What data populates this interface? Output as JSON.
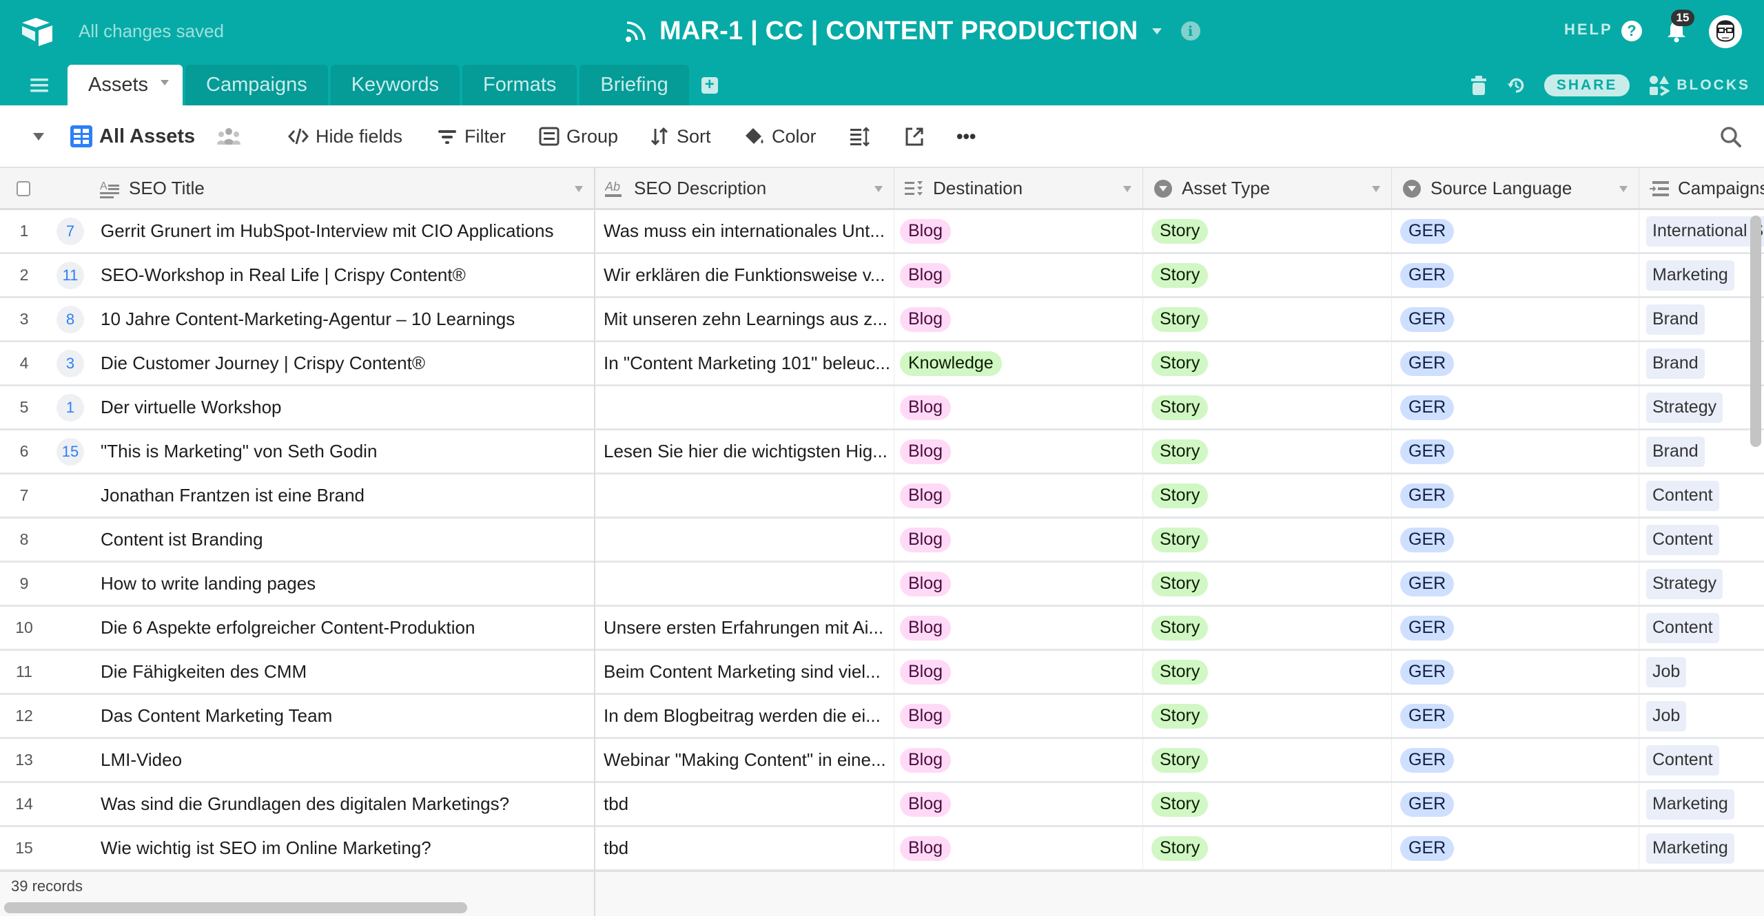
{
  "app": {
    "save_status": "All changes saved",
    "base_title": "MAR-1 | CC | CONTENT PRODUCTION",
    "help_label": "HELP",
    "notification_count": "15",
    "accent_color": "#06aba7"
  },
  "tabs": [
    {
      "label": "Assets",
      "active": true
    },
    {
      "label": "Campaigns",
      "active": false
    },
    {
      "label": "Keywords",
      "active": false
    },
    {
      "label": "Formats",
      "active": false
    },
    {
      "label": "Briefing",
      "active": false
    }
  ],
  "header_actions": {
    "share_label": "SHARE",
    "blocks_label": "BLOCKS"
  },
  "toolbar": {
    "view_name": "All Assets",
    "hide_fields": "Hide fields",
    "filter": "Filter",
    "group": "Group",
    "sort": "Sort",
    "color": "Color",
    "more": "•••"
  },
  "columns": [
    {
      "key": "title",
      "label": "SEO Title",
      "icon": "long-text-icon"
    },
    {
      "key": "desc",
      "label": "SEO Description",
      "icon": "single-line-text-icon"
    },
    {
      "key": "dest",
      "label": "Destination",
      "icon": "multi-select-icon"
    },
    {
      "key": "type",
      "label": "Asset Type",
      "icon": "single-select-icon"
    },
    {
      "key": "lang",
      "label": "Source Language",
      "icon": "single-select-icon"
    },
    {
      "key": "camp",
      "label": "Campaigns",
      "icon": "linked-record-icon"
    }
  ],
  "pill_colors": {
    "Blog": {
      "bg": "#ffdaf6",
      "fg": "#4c0c3e"
    },
    "Knowledge": {
      "bg": "#d1f7c4",
      "fg": "#0b1d05"
    },
    "Story": {
      "bg": "#d1f7c4",
      "fg": "#0b1d05"
    },
    "GER": {
      "bg": "#cfdfff",
      "fg": "#102046"
    }
  },
  "rows": [
    {
      "num": "1",
      "comments": "7",
      "title": "Gerrit Grunert im HubSpot-Interview mit CIO Applications",
      "desc": "Was muss ein internationales Unt...",
      "dest": "Blog",
      "type": "Story",
      "lang": "GER",
      "camp": "International S"
    },
    {
      "num": "2",
      "comments": "11",
      "title": "SEO-Workshop in Real Life | Crispy Content®",
      "desc": "Wir erklären die Funktionsweise v...",
      "dest": "Blog",
      "type": "Story",
      "lang": "GER",
      "camp": "Marketing"
    },
    {
      "num": "3",
      "comments": "8",
      "title": "10 Jahre Content-Marketing-Agentur – 10 Learnings",
      "desc": "Mit unseren zehn Learnings aus z...",
      "dest": "Blog",
      "type": "Story",
      "lang": "GER",
      "camp": "Brand"
    },
    {
      "num": "4",
      "comments": "3",
      "title": "Die Customer Journey | Crispy Content®",
      "desc": "In \"Content Marketing 101\" beleuc...",
      "dest": "Knowledge",
      "type": "Story",
      "lang": "GER",
      "camp": "Brand"
    },
    {
      "num": "5",
      "comments": "1",
      "title": "Der virtuelle Workshop",
      "desc": "",
      "dest": "Blog",
      "type": "Story",
      "lang": "GER",
      "camp": "Strategy"
    },
    {
      "num": "6",
      "comments": "15",
      "title": "\"This is Marketing\" von Seth Godin",
      "desc": "Lesen Sie hier die wichtigsten Hig...",
      "dest": "Blog",
      "type": "Story",
      "lang": "GER",
      "camp": "Brand"
    },
    {
      "num": "7",
      "comments": "",
      "title": "Jonathan Frantzen ist eine Brand",
      "desc": "",
      "dest": "Blog",
      "type": "Story",
      "lang": "GER",
      "camp": "Content"
    },
    {
      "num": "8",
      "comments": "",
      "title": "Content ist Branding",
      "desc": "",
      "dest": "Blog",
      "type": "Story",
      "lang": "GER",
      "camp": "Content"
    },
    {
      "num": "9",
      "comments": "",
      "title": "How to write landing pages",
      "desc": "",
      "dest": "Blog",
      "type": "Story",
      "lang": "GER",
      "camp": "Strategy"
    },
    {
      "num": "10",
      "comments": "",
      "title": "Die 6 Aspekte erfolgreicher Content-Produktion",
      "desc": "Unsere ersten Erfahrungen mit Ai...",
      "dest": "Blog",
      "type": "Story",
      "lang": "GER",
      "camp": "Content"
    },
    {
      "num": "11",
      "comments": "",
      "title": "Die Fähigkeiten des CMM",
      "desc": "Beim Content Marketing sind viel...",
      "dest": "Blog",
      "type": "Story",
      "lang": "GER",
      "camp": "Job"
    },
    {
      "num": "12",
      "comments": "",
      "title": "Das Content Marketing Team",
      "desc": "In dem Blogbeitrag werden die ei...",
      "dest": "Blog",
      "type": "Story",
      "lang": "GER",
      "camp": "Job"
    },
    {
      "num": "13",
      "comments": "",
      "title": "LMI-Video",
      "desc": "Webinar \"Making Content\" in eine...",
      "dest": "Blog",
      "type": "Story",
      "lang": "GER",
      "camp": "Content"
    },
    {
      "num": "14",
      "comments": "",
      "title": "Was sind die Grundlagen des digitalen Marketings?",
      "desc": "tbd",
      "dest": "Blog",
      "type": "Story",
      "lang": "GER",
      "camp": "Marketing"
    },
    {
      "num": "15",
      "comments": "",
      "title": "Wie wichtig ist SEO im Online Marketing?",
      "desc": "tbd",
      "dest": "Blog",
      "type": "Story",
      "lang": "GER",
      "camp": "Marketing"
    }
  ],
  "footer": {
    "records_label": "39 records"
  }
}
